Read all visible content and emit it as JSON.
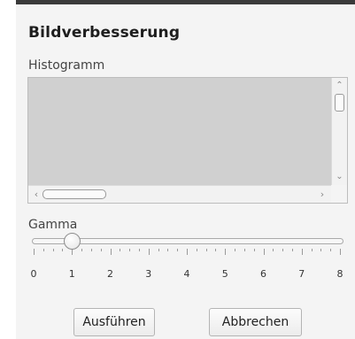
{
  "dialog": {
    "title": "Bildverbesserung",
    "histogram_label": "Histogramm",
    "gamma_label": "Gamma"
  },
  "slider": {
    "min": 0,
    "max": 8,
    "value": 1,
    "tick_labels": [
      "0",
      "1",
      "2",
      "3",
      "4",
      "5",
      "6",
      "7",
      "8"
    ]
  },
  "buttons": {
    "execute": "Ausführen",
    "cancel": "Abbrechen"
  },
  "icons": {
    "scroll_up": "chevron-up-icon",
    "scroll_down": "chevron-down-icon",
    "scroll_left": "chevron-left-icon",
    "scroll_right": "chevron-right-icon"
  }
}
